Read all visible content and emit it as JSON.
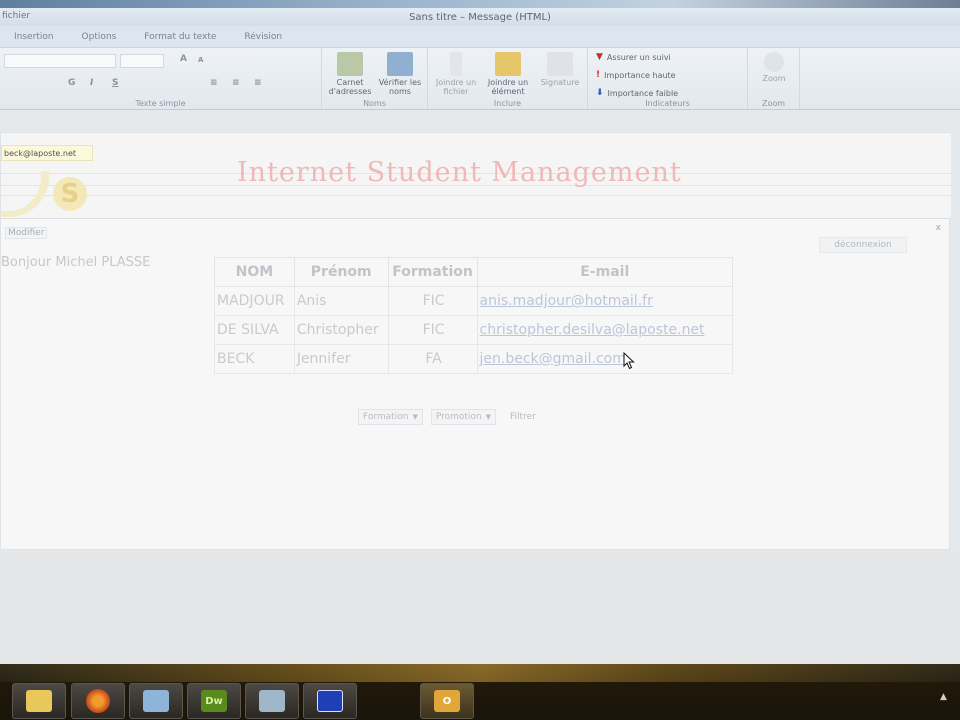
{
  "window": {
    "title": "Sans titre – Message (HTML)",
    "app_label": "fichier"
  },
  "ribbon": {
    "tabs": [
      "Insertion",
      "Options",
      "Format du texte",
      "Révision"
    ],
    "font_field": "",
    "style_labels": [
      "A",
      "A"
    ],
    "format_buttons": [
      "G",
      "I",
      "S"
    ],
    "groups": {
      "font": "Texte simple",
      "names": "Noms",
      "include": "Inclure",
      "tags": "Indicateurs",
      "zoom": "Zoom"
    },
    "buttons": {
      "address_book": "Carnet d'adresses",
      "check_names": "Vérifier les noms",
      "attach_file": "Joindre un fichier",
      "attach_item": "Joindre un élément",
      "signature": "Signature",
      "follow_up": "Assurer un suivi",
      "high_importance": "Importance haute",
      "low_importance": "Importance faible",
      "zoom": "Zoom"
    }
  },
  "page": {
    "email": "beck@laposte.net",
    "logo_letter": "S",
    "title": "Internet Student Management",
    "close": "x",
    "profile_link": "Modifier",
    "logout": "déconnexion",
    "greeting": "Bonjour Michel PLASSE",
    "table": {
      "headers": [
        "NOM",
        "Prénom",
        "Formation",
        "E-mail"
      ],
      "rows": [
        [
          "MADJOUR",
          "Anis",
          "FIC",
          "anis.madjour@hotmail.fr"
        ],
        [
          "DE SILVA",
          "Christopher",
          "FIC",
          "christopher.desilva@laposte.net"
        ],
        [
          "BECK",
          "Jennifer",
          "FA",
          "jen.beck@gmail.com"
        ]
      ]
    },
    "filters": {
      "formation": "Formation",
      "promotion": "Promotion",
      "button": "Filtrer"
    }
  },
  "taskbar": {
    "items": [
      {
        "name": "explorer",
        "color": "#e8c85a",
        "label": ""
      },
      {
        "name": "firefox",
        "color": "#e06a1f",
        "label": ""
      },
      {
        "name": "virtualbox",
        "color": "#8fb4d9",
        "label": ""
      },
      {
        "name": "dreamweaver",
        "color": "#5a8a1c",
        "label": "Dw"
      },
      {
        "name": "app",
        "color": "#9fb6c8",
        "label": ""
      },
      {
        "name": "app-blue",
        "color": "#1f3fb5",
        "label": ""
      },
      {
        "name": "outlook",
        "color": "#e0a63a",
        "label": "O"
      }
    ]
  }
}
